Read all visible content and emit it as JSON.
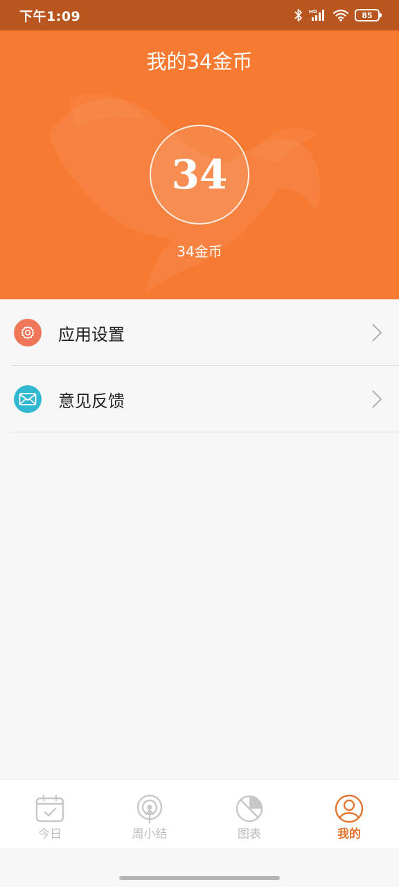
{
  "status_bar": {
    "time": "下午1:09",
    "battery": "85"
  },
  "header": {
    "title": "我的34金币",
    "coins": "34",
    "coins_label": "34金币"
  },
  "menu": {
    "items": [
      {
        "label": "应用设置",
        "icon": "gear-icon"
      },
      {
        "label": "意见反馈",
        "icon": "mail-icon"
      }
    ]
  },
  "tabs": [
    {
      "label": "今日",
      "icon": "calendar-check-icon",
      "active": false
    },
    {
      "label": "周小结",
      "icon": "broadcast-icon",
      "active": false
    },
    {
      "label": "图表",
      "icon": "pie-chart-icon",
      "active": false
    },
    {
      "label": "我的",
      "icon": "user-icon",
      "active": true
    }
  ],
  "colors": {
    "header_bg": "#f77a32",
    "status_bar_bg": "#b9561f",
    "active_tab": "#e4752f",
    "settings_icon_bg": "#f0765a",
    "feedback_icon_bg": "#2fb8d0"
  }
}
